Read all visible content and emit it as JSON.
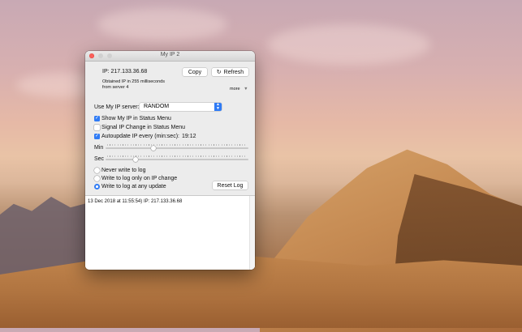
{
  "window": {
    "title": "My IP 2"
  },
  "ip": {
    "label": "IP: 217.133.36.68",
    "obtained": "Obtained IP in 255 milliseconds",
    "server": "from server 4",
    "more_label": "more",
    "more_icon": "triangle-down-icon"
  },
  "buttons": {
    "copy": "Copy",
    "refresh": "Refresh",
    "reset_log": "Reset Log"
  },
  "server_select": {
    "label": "Use My IP server:",
    "value": "RANDOM"
  },
  "checkboxes": [
    {
      "label": "Show My IP in Status Menu",
      "checked": true
    },
    {
      "label": "Signal IP Change in Status Menu",
      "checked": false
    },
    {
      "label": "Autoupdate IP every (min:sec):",
      "checked": true
    }
  ],
  "autoupdate_value": "19:12",
  "sliders": {
    "min": {
      "label": "Min",
      "value_fraction": 0.33
    },
    "sec": {
      "label": "Sec",
      "value_fraction": 0.2
    }
  },
  "log_options": [
    {
      "label": "Never write to log",
      "selected": false
    },
    {
      "label": "Write to log only on IP change",
      "selected": false
    },
    {
      "label": "Write to log at any update",
      "selected": true
    }
  ],
  "log": {
    "entries": [
      "13 Dec 2018 at 11:55:54) IP: 217.133.36.68"
    ]
  },
  "colors": {
    "accent": "#2f7bf5",
    "close": "#fc605b"
  }
}
